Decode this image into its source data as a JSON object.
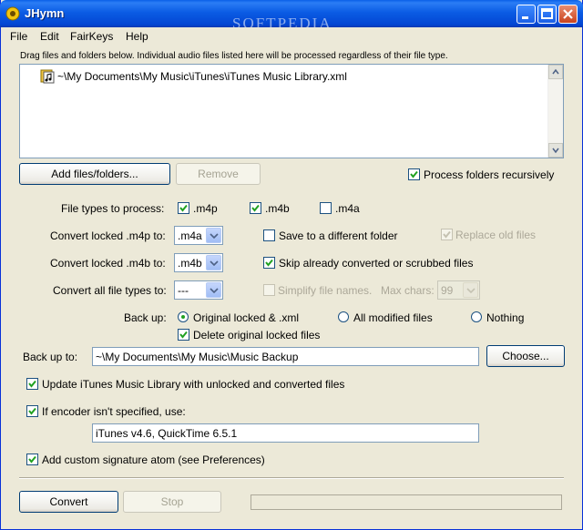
{
  "window": {
    "title": "JHymn",
    "watermark": "SOFTPEDIA"
  },
  "menu": {
    "items": [
      "File",
      "Edit",
      "FairKeys",
      "Help"
    ]
  },
  "files": {
    "hint": "Drag files and folders below. Individual audio files listed here will be processed regardless of their file type.",
    "items": [
      "~\\My Documents\\My Music\\iTunes\\iTunes Music Library.xml"
    ],
    "add_label": "Add files/folders...",
    "remove_label": "Remove",
    "recursive_label": "Process folders recursively",
    "recursive_checked": true
  },
  "types": {
    "label": "File types to process:",
    "m4p": {
      "label": ".m4p",
      "checked": true
    },
    "m4b": {
      "label": ".m4b",
      "checked": true
    },
    "m4a": {
      "label": ".m4a",
      "checked": false
    }
  },
  "convert": {
    "m4p_label": "Convert locked .m4p to:",
    "m4p_value": ".m4a",
    "m4b_label": "Convert locked .m4b to:",
    "m4b_value": ".m4b",
    "all_label": "Convert all file types to:",
    "all_value": "---"
  },
  "options": {
    "save_folder": {
      "label": "Save to a different folder",
      "checked": false
    },
    "replace_old": {
      "label": "Replace old files",
      "checked": true
    },
    "skip": {
      "label": "Skip already converted or scrubbed files",
      "checked": true
    },
    "simplify": {
      "label": "Simplify file names.",
      "checked": false
    },
    "max_chars_label": "Max chars:",
    "max_chars_value": "99"
  },
  "backup": {
    "label": "Back up:",
    "opt_original": "Original locked & .xml",
    "opt_modified": "All modified files",
    "opt_nothing": "Nothing",
    "selected": "original",
    "delete_label": "Delete original locked files",
    "delete_checked": true,
    "to_label": "Back up to:",
    "to_value": "~\\My Documents\\My Music\\Music Backup",
    "choose_label": "Choose..."
  },
  "update_itunes": {
    "label": "Update iTunes Music Library with unlocked and converted files",
    "checked": true
  },
  "encoder": {
    "label": "If encoder isn't specified, use:",
    "checked": true,
    "value": "iTunes v4.6, QuickTime 6.5.1"
  },
  "signature": {
    "label": "Add custom signature atom (see Preferences)",
    "checked": true
  },
  "actions": {
    "convert_label": "Convert",
    "stop_label": "Stop",
    "progress": 0
  },
  "colors": {
    "titlebar": "#0054e3",
    "face": "#ece9d8",
    "check": "#21a121"
  }
}
